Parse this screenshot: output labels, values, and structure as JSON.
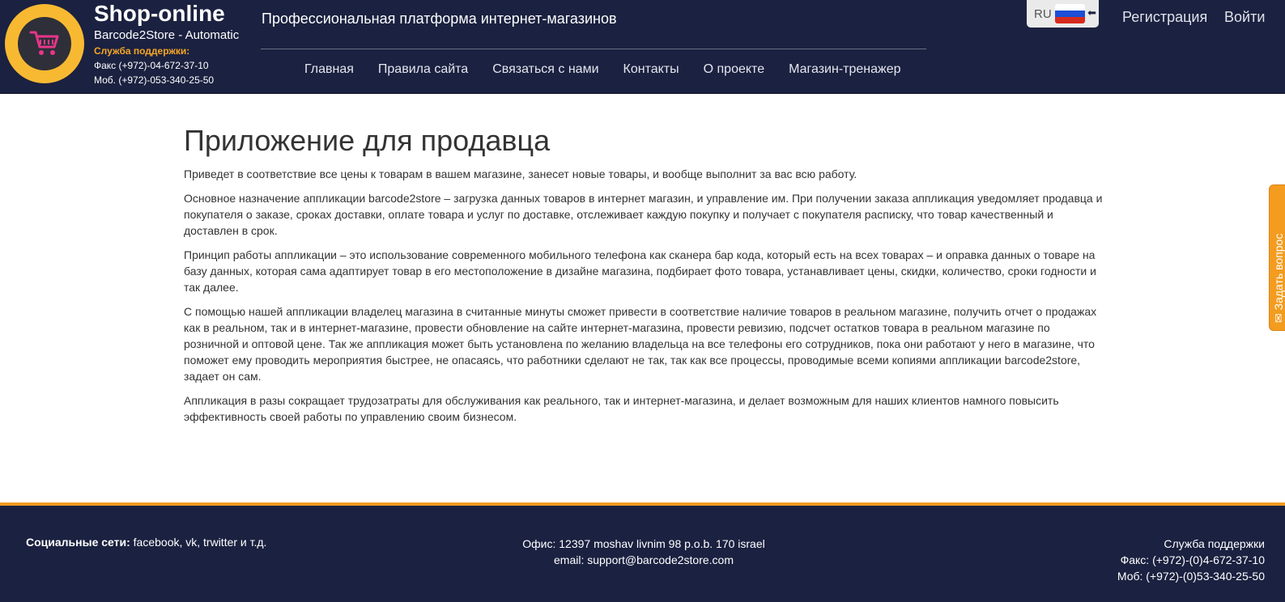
{
  "header": {
    "brand_title": "Shop-online",
    "brand_subtitle": "Barcode2Store - Automatic",
    "support_label": "Служба поддержки:",
    "fax": "Факс (+972)-04-672-37-10",
    "mobile": "Моб. (+972)-053-340-25-50",
    "tagline": "Профессиональная платформа интернет-магазинов",
    "nav": [
      {
        "label": "Главная"
      },
      {
        "label": "Правила сайта"
      },
      {
        "label": "Связаться с нами"
      },
      {
        "label": "Контакты"
      },
      {
        "label": "О проекте"
      },
      {
        "label": "Магазин-тренажер"
      }
    ],
    "language_code": "RU",
    "register_label": "Регистрация",
    "login_label": "Войти"
  },
  "main": {
    "title": "Приложение для продавца",
    "paragraphs": [
      "Приведет в соответствие все цены к товарам в вашем магазине, занесет новые товары, и вообще выполнит за вас всю работу.",
      "Основное назначение аппликации barcode2store – загрузка данных товаров в интернет магазин, и управление им. При получении заказа аппликация уведомляет продавца и покупателя о заказе, сроках доставки, оплате товара и услуг по доставке, отслеживает каждую покупку и получает с покупателя расписку, что товар качественный и доставлен в срок.",
      "Принцип работы аппликации – это использование современного мобильного телефона как сканера бар кода, который есть на всех товарах – и оправка данных о товаре на базу данных, которая сама адаптирует товар в его местоположение в дизайне магазина, подбирает фото товара, устанавливает цены, скидки, количество, сроки годности и так далее.",
      "С помощью нашей аппликации владелец магазина в считанные минуты сможет привести в соответствие наличие товаров в реальном магазине, получить отчет о продажах как в реальном, так и в интернет-магазине, провести обновление на сайте интернет-магазина, провести ревизию, подсчет остатков товара в реальном магазине по розничной и оптовой цене. Так же аппликация может быть установлена по желанию владельца на все телефоны его сотрудников, пока они работают у него в магазине, что поможет ему проводить мероприятия быстрее, не опасаясь, что работники сделают не так, так как все процессы, проводимые всеми копиями аппликации barcode2store, задает он сам.",
      "Аппликация в разы сокращает трудозатраты для обслуживания как реального, так и интернет-магазина, и делает возможным для наших клиентов намного повысить эффективность своей работы по управлению своим бизнесом."
    ]
  },
  "side_tab": {
    "label": "Задать вопрос",
    "icon": "envelope-icon"
  },
  "footer": {
    "social_label": "Социальные сети:",
    "social_links": "facebook, vk, trwitter и т.д.",
    "office": "Офис: 12397 moshav livnim 98 p.o.b. 170 israel",
    "email": "email: support@barcode2store.com",
    "support_title": "Служба поддержки",
    "fax": "Факс: (+972)-(0)4-672-37-10",
    "mobile": "Моб: (+972)-(0)53-340-25-50"
  },
  "colors": {
    "header_bg": "#1b2140",
    "accent_orange": "#f39c1f",
    "logo_ring": "#f8b932",
    "cart_pink": "#e8358a"
  }
}
